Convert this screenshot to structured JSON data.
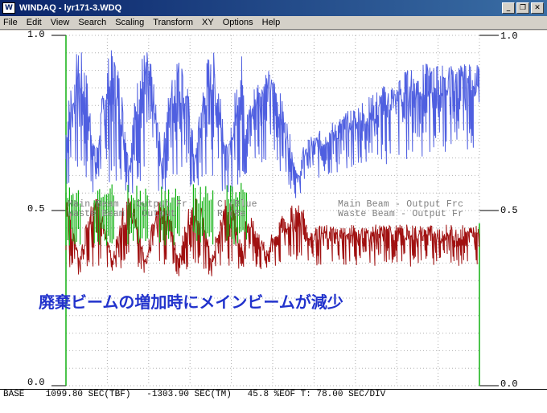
{
  "window": {
    "title": "WINDAQ - lyr171-3.WDQ",
    "icon": "windaq-app-icon",
    "buttons": {
      "minimize": "_",
      "restore": "❐",
      "close": "✕"
    }
  },
  "menu": [
    "File",
    "Edit",
    "View",
    "Search",
    "Scaling",
    "Transform",
    "XY",
    "Options",
    "Help"
  ],
  "axis": {
    "left_top": "1.0",
    "left_mid": "0.5",
    "left_bottom": "0.0",
    "right_top": "1.0",
    "right_mid": "0.5",
    "right_bottom": "0.0"
  },
  "channel_labels": {
    "ch1_left": "Main Beam - Output Fr",
    "ch1_left2": "C (Blue",
    "ch1_right": "Main Beam - Output Frc",
    "ch2_left": "Waste Beam - Output",
    "ch2_left2": "R (Re",
    "ch2_right": "Waste Beam - Output Fr"
  },
  "annotation": "廃棄ビームの増加時にメインビームが減少",
  "status": "BASE    1099.80 SEC(TBF)   -1303.90 SEC(TM)   45.8 %EOF T: 78.00 SEC/DIV",
  "colors": {
    "blue_trace": "#4f5fe0",
    "red_trace": "#a01010",
    "green_trace": "#10b010",
    "annotation": "#2233cc",
    "grid": "#b0b0b0"
  }
}
